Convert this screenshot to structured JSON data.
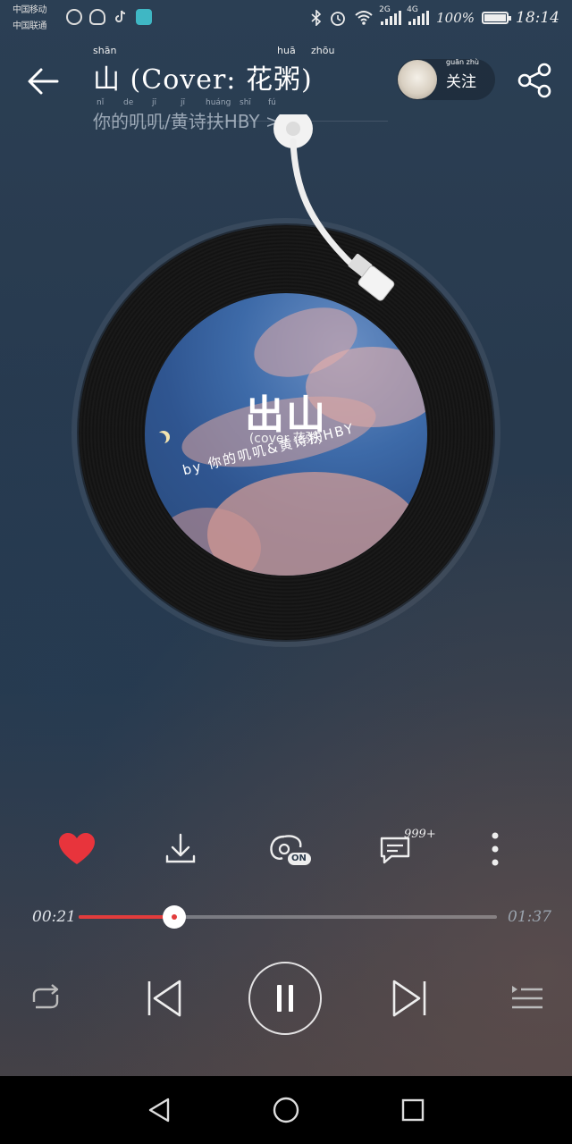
{
  "status_bar": {
    "carrier_lines": [
      "中国移动",
      "中国联通"
    ],
    "network_labels": [
      "2G",
      "4G"
    ],
    "battery": "100%",
    "time": "18:14"
  },
  "header": {
    "title": "山 (Cover: 花粥)",
    "title_ruby": [
      "shān",
      "huā",
      "zhōu"
    ],
    "artists": "你的叽叽/黄诗扶HBY >",
    "artists_ruby": [
      "nǐ",
      "de",
      "jī",
      "jī",
      "huáng",
      "shī",
      "fú"
    ],
    "follow_label": "关注",
    "follow_ruby": "guān zhù"
  },
  "cover": {
    "title": "出山",
    "subtitle": "(cover 花粥)",
    "credit": "by 你的叽叽&黄诗扶HBY"
  },
  "actions": {
    "comments_badge": "999+",
    "hq_badge": "ON",
    "liked": true
  },
  "player": {
    "current_time": "00:21",
    "total_time": "01:37",
    "progress_fraction": 0.228
  },
  "icons": {
    "back": "back-arrow-icon",
    "share": "share-icon",
    "like": "heart-icon",
    "download": "download-icon",
    "hq": "sound-effect-icon",
    "comments": "comment-icon",
    "more": "more-vertical-icon",
    "repeat": "repeat-icon",
    "prev": "previous-icon",
    "pause": "pause-icon",
    "next": "next-icon",
    "playlist": "playlist-icon"
  },
  "colors": {
    "accent": "#e23c3c",
    "like": "#e8343c",
    "cover_sky": "#3d6aa8"
  }
}
